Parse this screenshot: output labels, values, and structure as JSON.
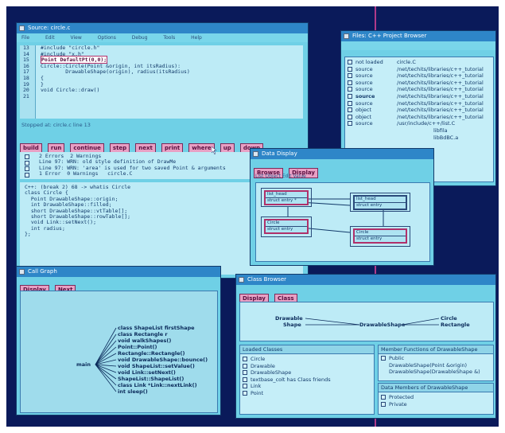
{
  "colors": {
    "desktop": "#0a1a5a",
    "window": "#6fd0e6",
    "titlebar": "#2e86c8",
    "button": "#e8a0c4",
    "highlight_border": "#b0306a"
  },
  "source_window": {
    "title": "Source: circle.c",
    "menu": [
      "File",
      "Edit",
      "View",
      "Options",
      "Debug",
      "Tools",
      "Help"
    ],
    "line_numbers": [
      "13",
      "14",
      "15",
      "16",
      "17",
      "18",
      "19",
      "20",
      "21"
    ],
    "code_lines": [
      "#include \"circle.h\"",
      "#include \"x.h\"",
      "",
      "Point DefaultPt(0,0);",
      "",
      "Circle::Circle(Point &origin, int itsRadius):",
      "        DrawableShape(origin), radius(itsRadius)",
      "{",
      "}",
      "",
      "void Circle::draw()"
    ],
    "status": "Stopped at: circle.c line 13",
    "buttons": [
      "build",
      "run",
      "continue",
      "step",
      "next",
      "print",
      "where",
      "up",
      "down"
    ],
    "messages": [
      "2 Errors  2 Warnings",
      "Line 97: WRN: old style definition of DrawMe",
      "Line 97: WRN: 'area' is used for two saved Point & arguments",
      "1 Error  0 Warnings   circle.C"
    ],
    "console_lines": [
      "C++: (break 2) 68 -> whatis Circle",
      "class Circle {",
      "  Point DrawableShape::origin;",
      "  int DrawableShape::filled;",
      "  short DrawableShape::vtTable[];",
      "  short DrawableShape::rowTable[];",
      "  void Link::setNext();",
      "  int radius;",
      "};"
    ]
  },
  "file_browser": {
    "title": "Files: C++ Project Browser",
    "rows": [
      {
        "status": "not loaded",
        "path": "circle.C"
      },
      {
        "status": "source",
        "path": "/net/techits/libraries/c++_tutorial"
      },
      {
        "status": "source",
        "path": "/net/techits/libraries/c++_tutorial"
      },
      {
        "status": "source",
        "path": "/net/techits/libraries/c++_tutorial"
      },
      {
        "status": "source",
        "path": "/net/techits/libraries/c++_tutorial"
      },
      {
        "status": "source",
        "path": "/net/techits/libraries/c++_tutorial"
      },
      {
        "status": "source",
        "path": "/net/techits/libraries/c++_tutorial"
      },
      {
        "status": "object",
        "path": "/net/techits/libraries/c++_tutorial"
      },
      {
        "status": "object",
        "path": "/net/techits/libraries/c++_tutorial"
      },
      {
        "status": "source",
        "path": "/usr/include/c++/list.C"
      }
    ],
    "tail": [
      "libfila",
      "libBdBC.a"
    ]
  },
  "data_display": {
    "title": "Data Display",
    "buttons": [
      "Browse",
      "Display"
    ],
    "subline": "List  Object  Edit  Value",
    "objects": [
      {
        "rows": [
          "list_head",
          "struct entry *"
        ]
      },
      {
        "rows": [
          "list_head",
          "struct entry"
        ]
      },
      {
        "rows": [
          "Circle",
          "struct entry"
        ]
      },
      {
        "rows": [
          "Circle",
          "struct entry"
        ]
      }
    ]
  },
  "call_graph": {
    "title": "Call Graph",
    "buttons": [
      "Display",
      "Next"
    ],
    "root": "main",
    "callees": [
      "class ShapeList firstShape",
      "class Rectangle r",
      "void walkShapes()",
      "Point::Point()",
      "Rectangle::Rectangle()",
      "void DrawableShape::bounce()",
      "void ShapeList::setValue()",
      "void Link::setNext()",
      "ShapeList::ShapeList()",
      "class Link *Link::nextLink()",
      "int sleep()"
    ]
  },
  "class_browser": {
    "title": "Class Browser",
    "buttons": [
      "Display",
      "Class"
    ],
    "graph": {
      "left_top": "Drawable",
      "left_bottom": "Shape",
      "center": "DrawableShape",
      "right_top": "Circle",
      "right_bottom": "Rectangle"
    },
    "loaded_header": "Loaded  Classes",
    "loaded_items": [
      "Circle",
      "Drawable",
      "DrawableShape",
      "textbase_colt has Class friends",
      "Link",
      "Point"
    ],
    "member_header": "Member  Functions of   DrawableShape",
    "member_items": [
      "Public",
      "DrawableShape(Point &origin)",
      "DrawableShape(DrawableShape &)"
    ],
    "data_header": "Data Members of   DrawableShape",
    "data_items": [
      "Protected",
      "Private"
    ]
  }
}
